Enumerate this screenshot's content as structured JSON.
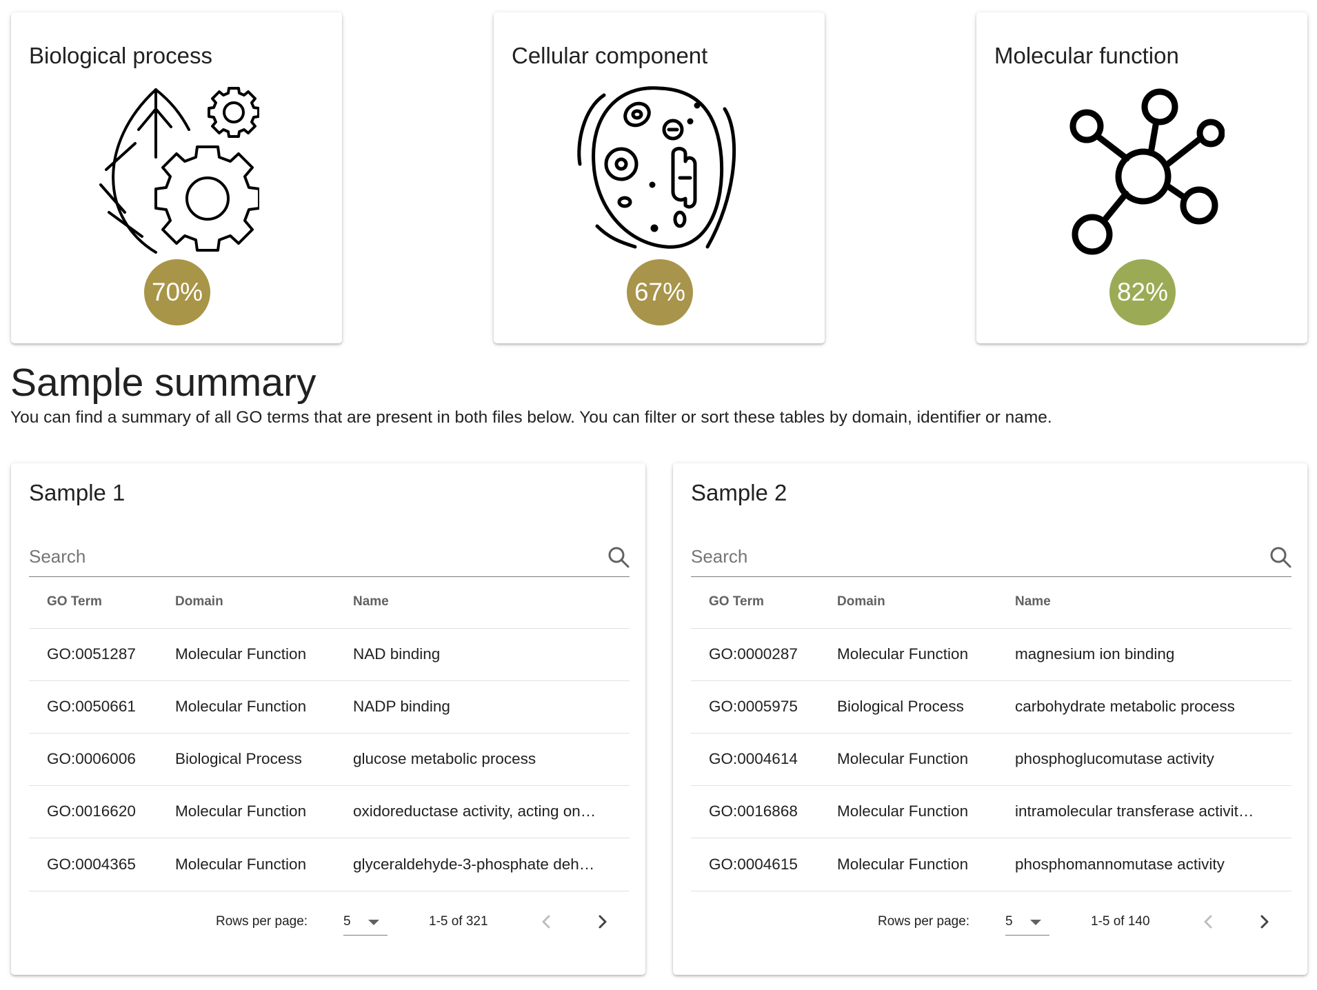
{
  "go_cards": [
    {
      "title": "Biological process",
      "icon": "leaf-gears-icon",
      "percent": "70%",
      "color": "#a89547"
    },
    {
      "title": "Cellular component",
      "icon": "cell-icon",
      "percent": "67%",
      "color": "#a8944a"
    },
    {
      "title": "Molecular function",
      "icon": "molecule-icon",
      "percent": "82%",
      "color": "#9bab55"
    }
  ],
  "summary": {
    "heading": "Sample summary",
    "description": "You can find a summary of all GO terms that are present in both files below. You can filter or sort these tables by domain, identifier or name."
  },
  "samples": [
    {
      "title": "Sample 1",
      "search_placeholder": "Search",
      "columns": [
        "GO Term",
        "Domain",
        "Name"
      ],
      "rows": [
        [
          "GO:0051287",
          "Molecular Function",
          "NAD binding"
        ],
        [
          "GO:0050661",
          "Molecular Function",
          "NADP binding"
        ],
        [
          "GO:0006006",
          "Biological Process",
          "glucose metabolic process"
        ],
        [
          "GO:0016620",
          "Molecular Function",
          "oxidoreductase activity, acting on…"
        ],
        [
          "GO:0004365",
          "Molecular Function",
          "glyceraldehyde-3-phosphate dehy…"
        ]
      ],
      "rows_per_page_label": "Rows per page:",
      "rows_per_page": "5",
      "range": "1-5 of 321"
    },
    {
      "title": "Sample 2",
      "search_placeholder": "Search",
      "columns": [
        "GO Term",
        "Domain",
        "Name"
      ],
      "rows": [
        [
          "GO:0000287",
          "Molecular Function",
          "magnesium ion binding"
        ],
        [
          "GO:0005975",
          "Biological Process",
          "carbohydrate metabolic process"
        ],
        [
          "GO:0004614",
          "Molecular Function",
          "phosphoglucomutase activity"
        ],
        [
          "GO:0016868",
          "Molecular Function",
          "intramolecular transferase activit…"
        ],
        [
          "GO:0004615",
          "Molecular Function",
          "phosphomannomutase activity"
        ]
      ],
      "rows_per_page_label": "Rows per page:",
      "rows_per_page": "5",
      "range": "1-5 of 140"
    }
  ]
}
